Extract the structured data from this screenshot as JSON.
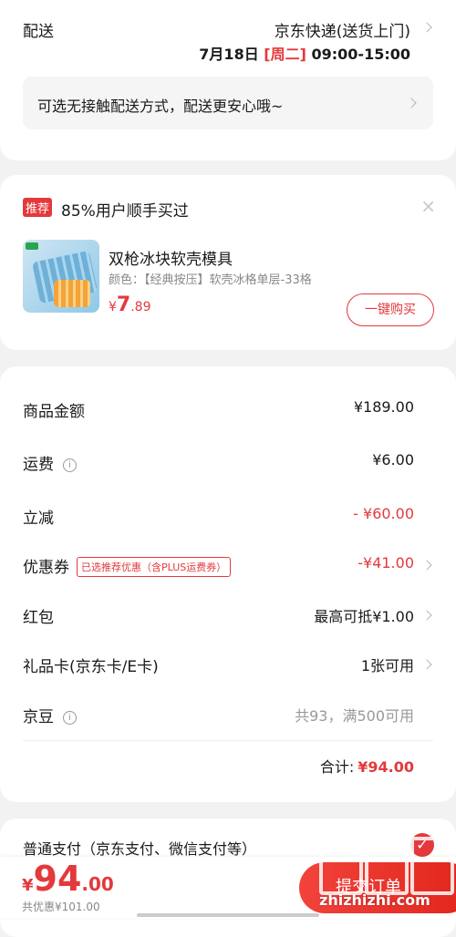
{
  "delivery": {
    "label": "配送",
    "method": "京东快递(送货上门)",
    "date": "7月18日",
    "weekday": "[周二]",
    "time": "09:00-15:00",
    "contactless": "可选无接触配送方式，配送更安心哦~"
  },
  "recommend": {
    "tag": "推荐",
    "title": "85%用户顺手买过",
    "close_icon": "×",
    "product_name": "双枪冰块软壳模具",
    "spec": "颜色：【经典按压】软壳冰格单层-33格",
    "price_symbol": "¥",
    "price_int": "7",
    "price_dec": ".89",
    "buy_label": "一键购买"
  },
  "summary": {
    "goods_label": "商品金额",
    "goods_value": "¥189.00",
    "shipping_label": "运费",
    "shipping_value": "¥6.00",
    "discount_label": "立减",
    "discount_value": "- ¥60.00",
    "coupon_label": "优惠券",
    "coupon_tag": "已选推荐优惠（含PLUS运费券）",
    "coupon_value": "-¥41.00",
    "redpack_label": "红包",
    "redpack_value": "最高可抵¥1.00",
    "giftcard_label": "礼品卡(京东卡/E卡)",
    "giftcard_value": "1张可用",
    "jingdou_label": "京豆",
    "jingdou_value": "共93，满500可用",
    "total_label": "合计:",
    "total_value": "¥94.00"
  },
  "payment": {
    "label": "普通支付（京东支付、微信支付等）",
    "check_icon": "✓"
  },
  "bottom": {
    "price_symbol": "¥",
    "price_int": "94",
    "price_dec": ".00",
    "saved": "共优惠¥101.00",
    "submit_label": "提交订单"
  },
  "watermark": {
    "text": "zhizhizhi.com"
  },
  "colors": {
    "accent": "#e4393c",
    "background": "#f2f2f2"
  }
}
